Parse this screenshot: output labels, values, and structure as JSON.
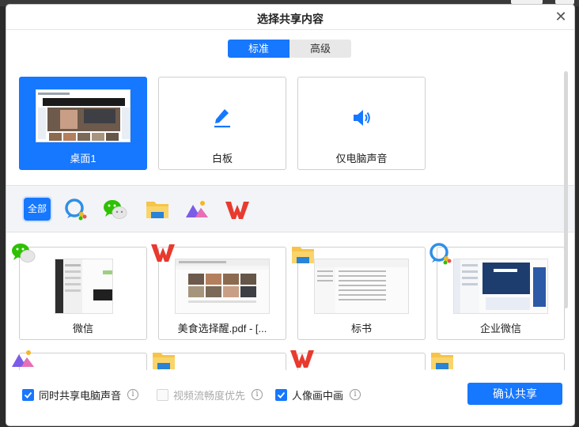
{
  "dialog": {
    "title": "选择共享内容",
    "close_glyph": "✕"
  },
  "tabs": [
    {
      "label": "标准",
      "active": true
    },
    {
      "label": "高级",
      "active": false
    }
  ],
  "big_options": [
    {
      "label": "桌面1",
      "icon": "desktop-thumbnail",
      "selected": true
    },
    {
      "label": "白板",
      "icon": "pen-icon",
      "selected": false
    },
    {
      "label": "仅电脑声音",
      "icon": "speaker-icon",
      "selected": false
    }
  ],
  "filters": {
    "all_label": "全部",
    "app_icons": [
      "wecom-icon",
      "wechat-icon",
      "folder-icon",
      "mountain-app-icon",
      "wps-icon"
    ]
  },
  "windows": [
    {
      "label": "微信",
      "app": "wechat-icon"
    },
    {
      "label": "美食选择醒.pdf - [...",
      "app": "wps-icon"
    },
    {
      "label": "标书",
      "app": "folder-icon"
    },
    {
      "label": "企业微信",
      "app": "wecom-icon"
    }
  ],
  "windows_row2_apps": [
    "mountain-app-icon",
    "folder-icon",
    "wps-icon",
    "folder-icon"
  ],
  "footer": {
    "options": [
      {
        "label": "同时共享电脑声音",
        "checked": true,
        "enabled": true
      },
      {
        "label": "视频流畅度优先",
        "checked": false,
        "enabled": false
      },
      {
        "label": "人像画中画",
        "checked": true,
        "enabled": true
      }
    ],
    "info_glyph": "i",
    "confirm_label": "确认共享"
  },
  "colors": {
    "accent": "#1677ff",
    "wps_red": "#e83a2e",
    "wechat_green": "#2dc100",
    "folder_yellow": "#f5c44a"
  }
}
